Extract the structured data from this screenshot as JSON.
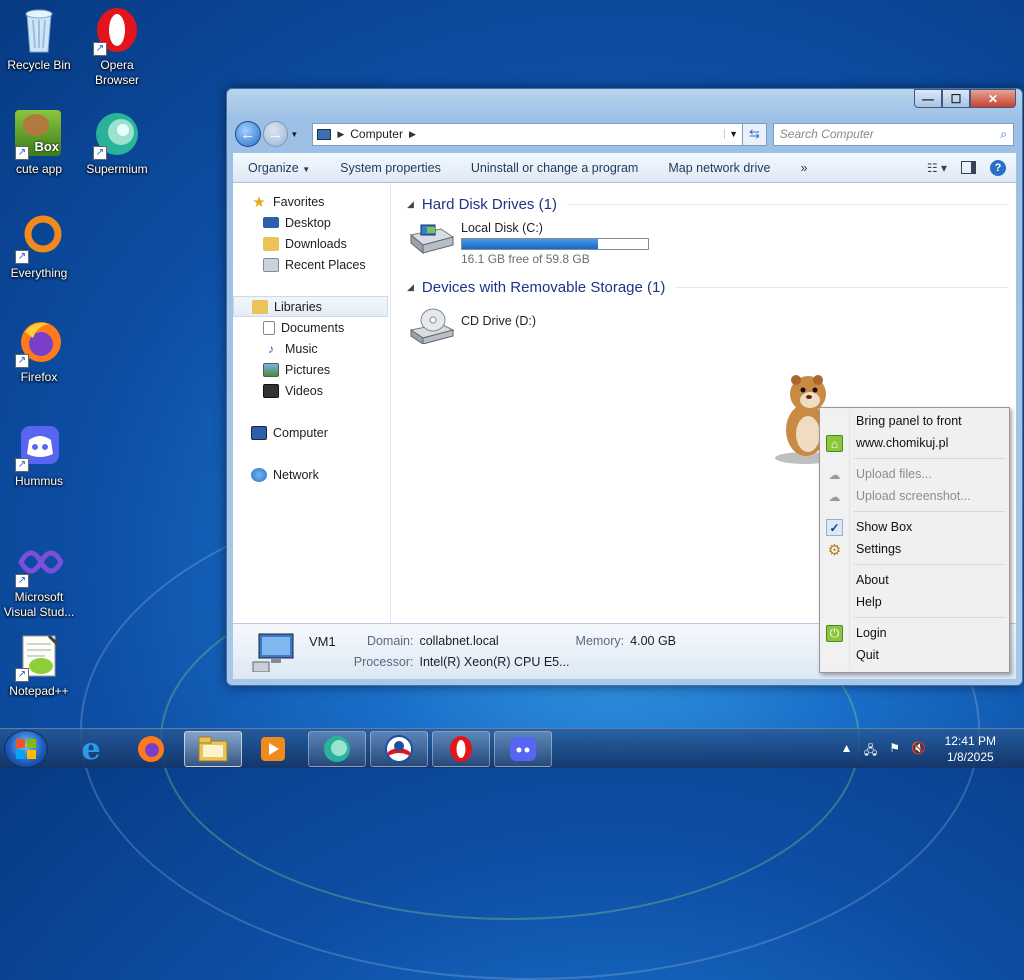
{
  "desktop": {
    "icons": [
      {
        "label": "Recycle Bin"
      },
      {
        "label": "Opera Browser"
      },
      {
        "label": "cute app",
        "badge": "Box"
      },
      {
        "label": "Supermium"
      },
      {
        "label": "Everything"
      },
      {
        "label": "Firefox"
      },
      {
        "label": "Hummus"
      },
      {
        "label": "Microsoft Visual Stud..."
      },
      {
        "label": "Notepad++"
      }
    ]
  },
  "explorer": {
    "titlebar": {
      "min": "—",
      "max": "☐",
      "close": "✕"
    },
    "address": {
      "segment": "Computer"
    },
    "search": {
      "placeholder": "Search Computer"
    },
    "toolbar": {
      "organize": "Organize",
      "system_properties": "System properties",
      "uninstall": "Uninstall or change a program",
      "map_drive": "Map network drive",
      "more": "»"
    },
    "nav": {
      "favorites": "Favorites",
      "desktop": "Desktop",
      "downloads": "Downloads",
      "recent": "Recent Places",
      "libraries": "Libraries",
      "documents": "Documents",
      "music": "Music",
      "pictures": "Pictures",
      "videos": "Videos",
      "computer": "Computer",
      "network": "Network"
    },
    "groups": {
      "hdd": "Hard Disk Drives (1)",
      "removable": "Devices with Removable Storage (1)"
    },
    "drives": {
      "local_name": "Local Disk (C:)",
      "local_free": "16.1 GB free of 59.8 GB",
      "local_used_fraction": 0.73,
      "cd_name": "CD Drive (D:)"
    },
    "details": {
      "name": "VM1",
      "domain_label": "Domain:",
      "domain_value": "collabnet.local",
      "memory_label": "Memory:",
      "memory_value": "4.00 GB",
      "processor_label": "Processor:",
      "processor_value": "Intel(R) Xeon(R) CPU E5..."
    }
  },
  "context_menu": {
    "bring_front": "Bring panel to front",
    "site": "www.chomikuj.pl",
    "upload_files": "Upload files...",
    "upload_screenshot": "Upload screenshot...",
    "show_box": "Show Box",
    "settings": "Settings",
    "about": "About",
    "help": "Help",
    "login": "Login",
    "quit": "Quit"
  },
  "taskbar": {
    "time": "12:41 PM",
    "date": "1/8/2025"
  },
  "colors": {
    "accent": "#1e3287",
    "progress": "#1867c7"
  }
}
